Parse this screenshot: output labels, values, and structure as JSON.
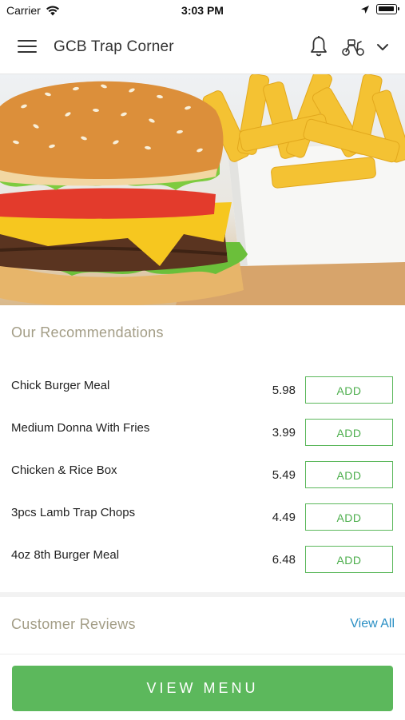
{
  "status_bar": {
    "carrier": "Carrier",
    "time": "3:03 PM"
  },
  "header": {
    "title": "GCB Trap Corner",
    "icons": [
      "menu-icon",
      "bell-icon",
      "scooter-icon",
      "chevron-down-icon"
    ]
  },
  "hero": {
    "alt": "burger-and-fries-image"
  },
  "recommendations": {
    "title": "Our Recommendations",
    "items": [
      {
        "name": "Chick Burger Meal",
        "price": "5.98",
        "button": "ADD"
      },
      {
        "name": "Medium Donna With Fries",
        "price": "3.99",
        "button": "ADD"
      },
      {
        "name": "Chicken & Rice Box",
        "price": "5.49",
        "button": "ADD"
      },
      {
        "name": "3pcs Lamb Trap Chops",
        "price": "4.49",
        "button": "ADD"
      },
      {
        "name": "4oz 8th Burger Meal",
        "price": "6.48",
        "button": "ADD"
      }
    ]
  },
  "reviews": {
    "title": "Customer Reviews",
    "view_all": "View All"
  },
  "footer": {
    "view_menu": "VIEW MENU"
  },
  "colors": {
    "accent_green": "#5cb85c",
    "section_title": "#a39d86",
    "link_blue": "#2a8fc4"
  }
}
